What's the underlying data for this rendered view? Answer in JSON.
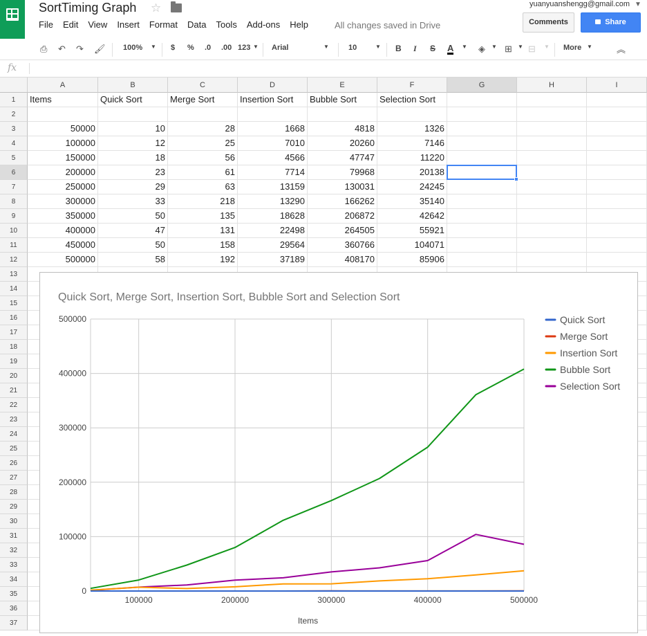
{
  "app": {
    "title": "SortTiming Graph",
    "account": "yuanyuanshengg@gmail.com",
    "save_status": "All changes saved in Drive",
    "comments_label": "Comments",
    "share_label": "Share"
  },
  "menu": [
    "File",
    "Edit",
    "View",
    "Insert",
    "Format",
    "Data",
    "Tools",
    "Add-ons",
    "Help"
  ],
  "toolbar": {
    "zoom": "100%",
    "currency": "$",
    "percent": "%",
    "decimal_less": ".0",
    "decimal_more": ".00",
    "number_format": "123",
    "font": "Arial",
    "font_size": "10",
    "bold": "B",
    "italic": "I",
    "strike": "S",
    "text_color": "A",
    "more": "More"
  },
  "formula_bar": {
    "fx": "fx",
    "value": ""
  },
  "sheet": {
    "columns": [
      "A",
      "B",
      "C",
      "D",
      "E",
      "F",
      "G",
      "H",
      "I"
    ],
    "selected_column": "G",
    "selected_row": "6",
    "rows": [
      [
        "Items",
        "Quick Sort",
        "Merge Sort",
        "Insertion Sort",
        "Bubble Sort",
        "Selection Sort"
      ],
      [
        "",
        "",
        "",
        "",
        "",
        ""
      ],
      [
        "50000",
        "10",
        "28",
        "1668",
        "4818",
        "1326"
      ],
      [
        "100000",
        "12",
        "25",
        "7010",
        "20260",
        "7146"
      ],
      [
        "150000",
        "18",
        "56",
        "4566",
        "47747",
        "11220"
      ],
      [
        "200000",
        "23",
        "61",
        "7714",
        "79968",
        "20138"
      ],
      [
        "250000",
        "29",
        "63",
        "13159",
        "130031",
        "24245"
      ],
      [
        "300000",
        "33",
        "218",
        "13290",
        "166262",
        "35140"
      ],
      [
        "350000",
        "50",
        "135",
        "18628",
        "206872",
        "42642"
      ],
      [
        "400000",
        "47",
        "131",
        "22498",
        "264505",
        "55921"
      ],
      [
        "450000",
        "50",
        "158",
        "29564",
        "360766",
        "104071"
      ],
      [
        "500000",
        "58",
        "192",
        "37189",
        "408170",
        "85906"
      ]
    ],
    "row_numbers": [
      "1",
      "2",
      "3",
      "4",
      "5",
      "6",
      "7",
      "8",
      "9",
      "10",
      "11",
      "12",
      "13",
      "14",
      "15",
      "16",
      "17",
      "18",
      "19",
      "20",
      "21",
      "22",
      "23",
      "24",
      "25",
      "26",
      "27",
      "28",
      "29",
      "30",
      "31",
      "32",
      "33",
      "34",
      "35",
      "36",
      "37"
    ]
  },
  "chart_data": {
    "type": "line",
    "title": "Quick Sort, Merge Sort, Insertion Sort, Bubble Sort and Selection Sort",
    "xlabel": "Items",
    "ylabel": "",
    "x": [
      50000,
      100000,
      150000,
      200000,
      250000,
      300000,
      350000,
      400000,
      450000,
      500000
    ],
    "xlim": [
      50000,
      500000
    ],
    "ylim": [
      0,
      500000
    ],
    "xticks": [
      "100000",
      "200000",
      "300000",
      "400000",
      "500000"
    ],
    "xtick_values": [
      100000,
      200000,
      300000,
      400000,
      500000
    ],
    "yticks": [
      "0",
      "100000",
      "200000",
      "300000",
      "400000",
      "500000"
    ],
    "ytick_values": [
      0,
      100000,
      200000,
      300000,
      400000,
      500000
    ],
    "grid": true,
    "legend_position": "right",
    "series": [
      {
        "name": "Quick Sort",
        "color": "#3366cc",
        "values": [
          10,
          12,
          18,
          23,
          29,
          33,
          50,
          47,
          50,
          58
        ]
      },
      {
        "name": "Merge Sort",
        "color": "#dc3912",
        "values": [
          28,
          25,
          56,
          61,
          63,
          218,
          135,
          131,
          158,
          192
        ]
      },
      {
        "name": "Insertion Sort",
        "color": "#ff9900",
        "values": [
          1668,
          7010,
          4566,
          7714,
          13159,
          13290,
          18628,
          22498,
          29564,
          37189
        ]
      },
      {
        "name": "Bubble Sort",
        "color": "#109618",
        "values": [
          4818,
          20260,
          47747,
          79968,
          130031,
          166262,
          206872,
          264505,
          360766,
          408170
        ]
      },
      {
        "name": "Selection Sort",
        "color": "#990099",
        "values": [
          1326,
          7146,
          11220,
          20138,
          24245,
          35140,
          42642,
          55921,
          104071,
          85906
        ]
      }
    ]
  }
}
